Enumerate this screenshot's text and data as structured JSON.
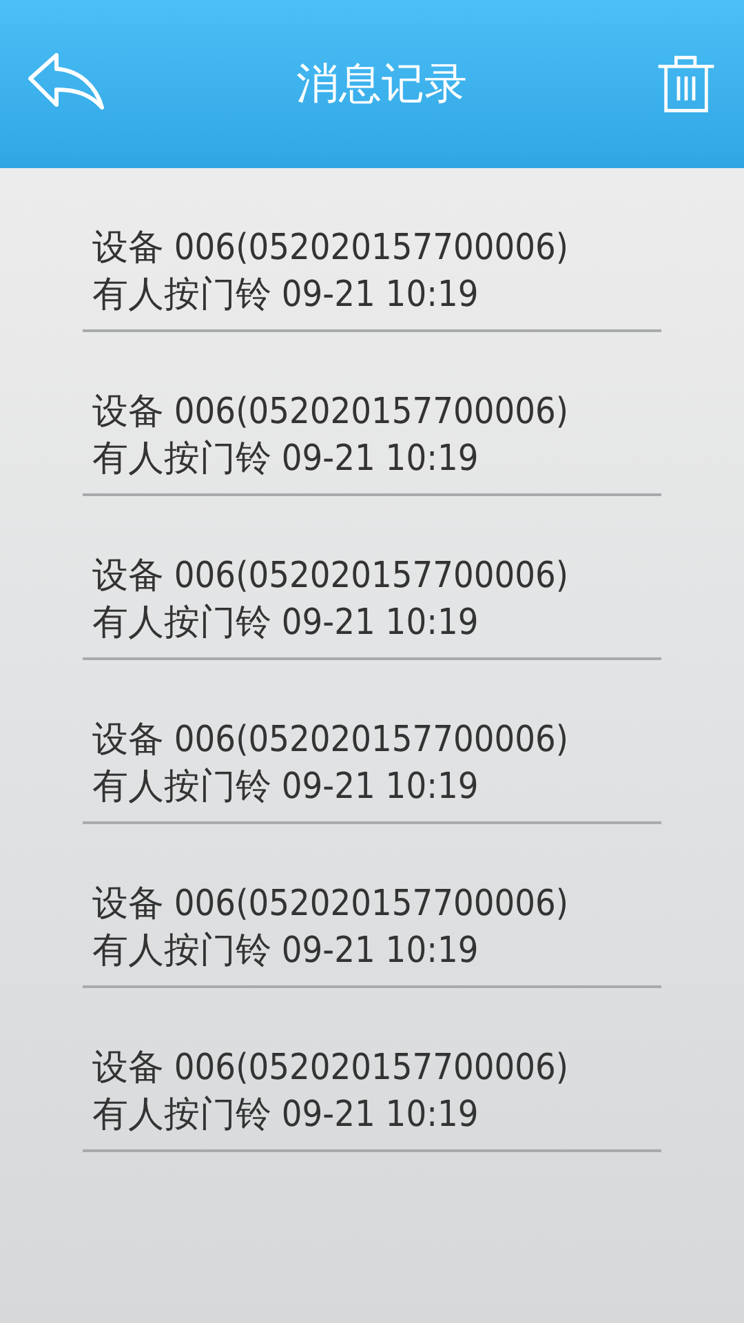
{
  "header": {
    "title": "消息记录"
  },
  "messages": [
    {
      "device": "设备 006(052020157700006)",
      "event": "有人按门铃 09-21 10:19"
    },
    {
      "device": "设备 006(052020157700006)",
      "event": "有人按门铃 09-21 10:19"
    },
    {
      "device": "设备 006(052020157700006)",
      "event": "有人按门铃 09-21 10:19"
    },
    {
      "device": "设备 006(052020157700006)",
      "event": "有人按门铃 09-21 10:19"
    },
    {
      "device": "设备 006(052020157700006)",
      "event": "有人按门铃 09-21 10:19"
    },
    {
      "device": "设备 006(052020157700006)",
      "event": "有人按门铃 09-21 10:19"
    }
  ]
}
